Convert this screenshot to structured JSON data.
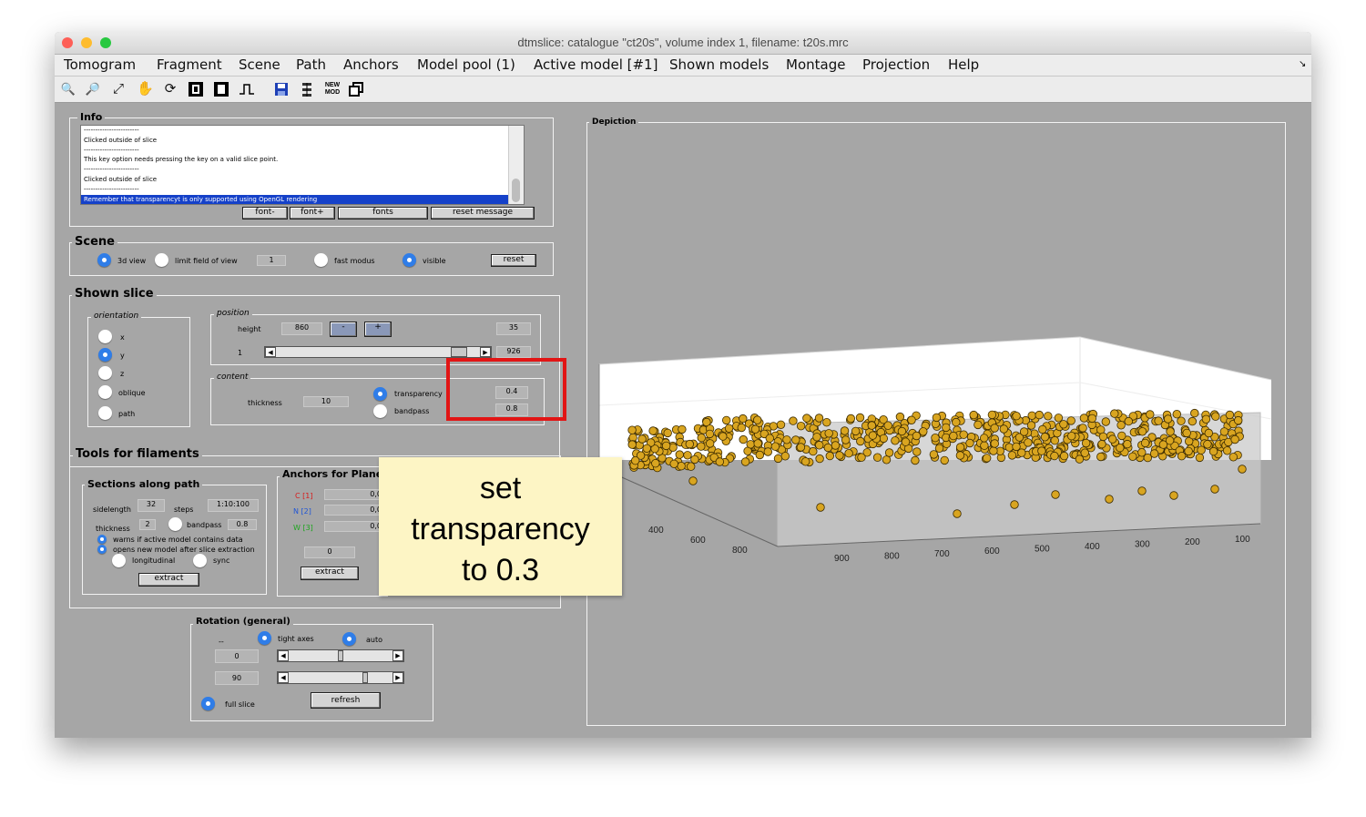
{
  "window": {
    "title": "dtmslice: catalogue \"ct20s\", volume index 1, filename: t20s.mrc",
    "traffic_lights": {
      "close": "#fe5f57",
      "minimize": "#febc2e",
      "zoom": "#28c840"
    }
  },
  "menu": [
    "Tomogram",
    "Fragment",
    "Scene",
    "Path",
    "Anchors",
    "Model pool (1)",
    "Active model [#1]",
    "Shown models",
    "Montage",
    "Projection",
    "Help"
  ],
  "toolbar": {
    "icons": [
      "zoom-in-icon",
      "zoom-out-icon",
      "fit-icon",
      "pan-hand-icon",
      "rotate-icon",
      "slice-black-icon",
      "slice-white-icon",
      "pulse-icon",
      "save-icon",
      "stack-icon",
      "new-model-icon",
      "duplicate-icon"
    ],
    "new_mod_label": "NEW\nMOD"
  },
  "info": {
    "title": "Info",
    "lines": [
      "------------------------",
      "Clicked outside of slice",
      "------------------------",
      "This key option needs pressing the key on a valid slice point.",
      "------------------------",
      "Clicked outside of slice",
      "------------------------",
      "Remember that transparencyt is only supported using OpenGL rendering"
    ],
    "buttons": {
      "font_minus": "font-",
      "font_plus": "font+",
      "fonts": "fonts",
      "reset_message": "reset message"
    }
  },
  "scene": {
    "title": "Scene",
    "view_3d": "3d view",
    "limit_fov": "limit field of view",
    "fov_value": "1",
    "fast_modus": "fast modus",
    "visible": "visible",
    "reset": "reset"
  },
  "shown_slice": {
    "title": "Shown slice",
    "orientation": {
      "title": "orientation",
      "options": [
        "x",
        "y",
        "z",
        "oblique",
        "path"
      ],
      "selected": "y"
    },
    "position": {
      "title": "position",
      "height_label": "height",
      "height_value": "860",
      "minus": "-",
      "plus": "+",
      "step": "35",
      "slider_label": "1",
      "max": "926",
      "slider_fraction": 0.93
    },
    "content": {
      "title": "content",
      "thickness_label": "thickness",
      "thickness_value": "10",
      "transparency_label": "transparency",
      "transparency_value": "0.4",
      "bandpass_label": "bandpass",
      "bandpass_value": "0.8"
    }
  },
  "filaments": {
    "title": "Tools for filaments",
    "sections": {
      "title": "Sections along path",
      "sidelength_label": "sidelength",
      "sidelength_value": "32",
      "steps_label": "steps",
      "steps_value": "1:10:100",
      "thickness_label": "thickness",
      "thickness_value": "2",
      "bandpass_label": "bandpass",
      "bandpass_value": "0.8",
      "warn_label": "warns if active model contains data",
      "opens_label": "opens new model after slice extraction",
      "longitudinal": "longitudinal",
      "sync": "sync",
      "extract": "extract"
    },
    "anchors": {
      "title": "Anchors for Plane",
      "rows": [
        {
          "label": "C [1]",
          "color": "#d81b1b",
          "value": "0,0"
        },
        {
          "label": "N [2]",
          "color": "#1f55d6",
          "value": "0,0"
        },
        {
          "label": "W [3]",
          "color": "#1fa51f",
          "value": "0,0"
        }
      ],
      "field_value": "0",
      "extract": "extract"
    }
  },
  "rotation": {
    "title": "Rotation (general)",
    "dash_label": "--",
    "tight_axes": "tight axes",
    "auto": "auto",
    "value1": "0",
    "value2": "90",
    "slider1_fraction": 0.5,
    "slider2_fraction": 0.75,
    "full_slice": "full slice",
    "refresh": "refresh"
  },
  "depiction": {
    "title": "Depiction",
    "axis_left_ticks": [
      "400",
      "600",
      "800"
    ],
    "axis_bottom_ticks": [
      "900",
      "800",
      "700",
      "600",
      "500",
      "400",
      "300",
      "200",
      "100"
    ],
    "particle_color": "#d9a520"
  },
  "annotation": {
    "callout": "set\ntransparency\nto 0.3",
    "highlight_color": "#e21515"
  }
}
